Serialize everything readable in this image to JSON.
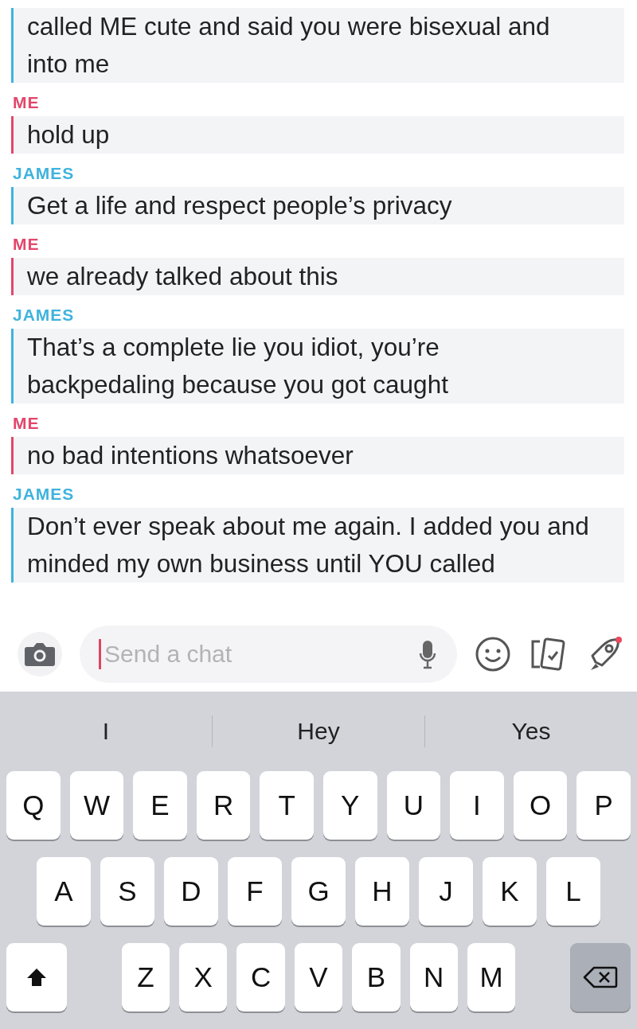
{
  "messages": [
    {
      "kind": "them",
      "text": "called ME cute and said you were bisexual and into me"
    },
    {
      "kind": "me",
      "sender": "ME",
      "text": "hold up"
    },
    {
      "kind": "them",
      "sender": "JAMES",
      "text": "Get a life and respect people’s privacy"
    },
    {
      "kind": "me",
      "sender": "ME",
      "text": "we already talked about this"
    },
    {
      "kind": "them",
      "sender": "JAMES",
      "text": "That’s a complete lie you idiot, you’re backpedaling because you got caught"
    },
    {
      "kind": "me",
      "sender": "ME",
      "text": "no bad intentions whatsoever"
    },
    {
      "kind": "them",
      "sender": "JAMES",
      "text": "Don’t ever speak about me again. I added you and minded my own business until YOU called"
    }
  ],
  "chat_input": {
    "placeholder": "Send a chat"
  },
  "keyboard": {
    "suggestions": [
      "I",
      "Hey",
      "Yes"
    ],
    "rows": [
      [
        "Q",
        "W",
        "E",
        "R",
        "T",
        "Y",
        "U",
        "I",
        "O",
        "P"
      ],
      [
        "A",
        "S",
        "D",
        "F",
        "G",
        "H",
        "J",
        "K",
        "L"
      ],
      [
        "Z",
        "X",
        "C",
        "V",
        "B",
        "N",
        "M"
      ]
    ]
  }
}
